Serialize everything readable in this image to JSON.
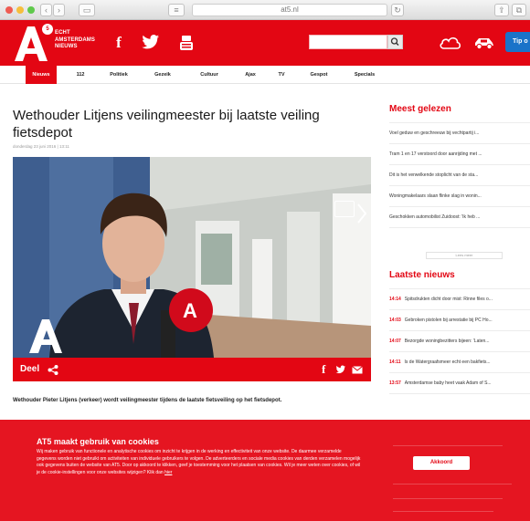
{
  "browser": {
    "url": "at5.nl"
  },
  "header": {
    "logo_letter": "A",
    "logo_badge": "5",
    "logo_lines": [
      "ECHT",
      "AMSTERDAMS",
      "NIEUWS"
    ],
    "facebook_glyph": "f",
    "tip_label": "Tip o",
    "icons": [
      "facebook-icon",
      "twitter-icon",
      "youtube-icon",
      "search-icon",
      "weather-cloud-icon",
      "traffic-car-icon"
    ]
  },
  "nav": {
    "items": [
      "Nieuws",
      "112",
      "Politiek",
      "Gezeik",
      "Cultuur",
      "Ajax",
      "TV",
      "Gespot",
      "Specials"
    ]
  },
  "article": {
    "title": "Wethouder Litjens veilingmeester bij laatste veiling fietsdepot",
    "date": "donderdag 23 juni 2016 | 13:11",
    "share_label": "Deel",
    "lead": "Wethouder Pieter Litjens (verkeer) wordt veilingmeester tijdens de laatste fietsveiling op het fietsdepot."
  },
  "sidebar": {
    "most_read_title": "Meest gelezen",
    "most_read": [
      "Voel geduw en geschreeuw bij vechtpartij i...",
      "Tram 1 en 17 verstoord door aanrijding met ...",
      "Dit is het verwelkende stoplicht van de sta...",
      "Woningmakelaars slaan flinke slag in wonin...",
      "Geschokken automobilist Zuidoost: 'Ik heb ..."
    ],
    "more_label": "Lees meer",
    "latest_title": "Laatste nieuws",
    "latest": [
      {
        "time": "14:14",
        "text": "Spitsdrukten dicht door mist: Rinne files o..."
      },
      {
        "time": "14:03",
        "text": "Gebroken pistolen bij arrestatie bij PC Ho..."
      },
      {
        "time": "14:07",
        "text": "Bezorgde woningbezitters bijeen: 'Laten..."
      },
      {
        "time": "14:11",
        "text": "Is de Watergraafsmeer echt een bakfiets..."
      },
      {
        "time": "13:57",
        "text": "Amsterdamse baby heet vaak Adam of S..."
      }
    ]
  },
  "cookie": {
    "title": "AT5 maakt gebruik van cookies",
    "text": "Wij maken gebruik van functionele en analytische cookies om inzicht te krijgen in de werking en effectiviteit van onze website. De daarmee verzamelde gegevens worden niet gebruikt om activiteiten van individuele gebruikers te volgen. De adverteerders en sociale media cookies van derden verzamelen mogelijk ook gegevens buiten de website van AT5. Door op akkoord te klikken, geef je toestemming voor het plaatsen van cookies. Wil je meer weten over cookies, of wil je de cookie-instellingen voor onze websites wijzigen? Klik dan",
    "link": "hier",
    "accept_label": "Akkoord"
  },
  "colors": {
    "brand_red": "#e30613",
    "tip_blue": "#1a73c9"
  }
}
